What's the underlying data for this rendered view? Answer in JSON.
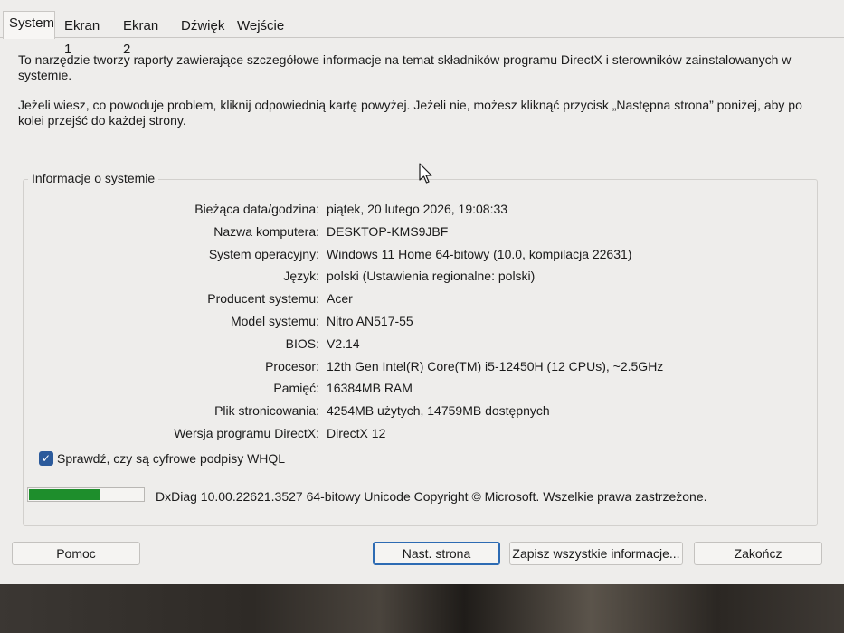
{
  "tabs": [
    {
      "label": "System",
      "active": true
    },
    {
      "label": "Ekran 1",
      "active": false
    },
    {
      "label": "Ekran 2",
      "active": false
    },
    {
      "label": "Dźwięk",
      "active": false
    },
    {
      "label": "Wejście",
      "active": false
    }
  ],
  "intro": {
    "p1": "To narzędzie tworzy raporty zawierające szczegółowe informacje na temat składników programu DirectX i sterowników zainstalowanych w systemie.",
    "p2": "Jeżeli wiesz, co powoduje problem, kliknij odpowiednią kartę powyżej. Jeżeli nie, możesz kliknąć przycisk „Następna strona” poniżej, aby po kolei przejść do każdej strony."
  },
  "system_info": {
    "title": "Informacje o systemie",
    "rows": [
      {
        "label": "Bieżąca data/godzina:",
        "value": "piątek, 20 lutego 2026, 19:08:33"
      },
      {
        "label": "Nazwa komputera:",
        "value": "DESKTOP-KMS9JBF"
      },
      {
        "label": "System operacyjny:",
        "value": "Windows 11 Home 64-bitowy (10.0, kompilacja 22631)"
      },
      {
        "label": "Język:",
        "value": "polski (Ustawienia regionalne: polski)"
      },
      {
        "label": "Producent systemu:",
        "value": "Acer"
      },
      {
        "label": "Model systemu:",
        "value": "Nitro AN517-55"
      },
      {
        "label": "BIOS:",
        "value": "V2.14"
      },
      {
        "label": "Procesor:",
        "value": "12th Gen Intel(R) Core(TM) i5-12450H (12 CPUs), ~2.5GHz"
      },
      {
        "label": "Pamięć:",
        "value": "16384MB RAM"
      },
      {
        "label": "Plik stronicowania:",
        "value": "4254MB użytych, 14759MB dostępnych"
      },
      {
        "label": "Wersja programu DirectX:",
        "value": "DirectX 12"
      }
    ]
  },
  "whql_check": {
    "label": "Sprawdź, czy są cyfrowe podpisy WHQL",
    "checked": true
  },
  "progress": {
    "fraction": 0.63
  },
  "footer_text": "DxDiag 10.00.22621.3527 64-bitowy Unicode  Copyright © Microsoft. Wszelkie prawa zastrzeżone.",
  "buttons": {
    "help": "Pomoc",
    "next": "Nast. strona",
    "save_all": "Zapisz wszystkie informacje...",
    "exit": "Zakończ"
  },
  "colors": {
    "progress_fill": "#1e8e2c",
    "checkbox": "#2b5a9b",
    "default_button_border": "#2d6bb3"
  }
}
